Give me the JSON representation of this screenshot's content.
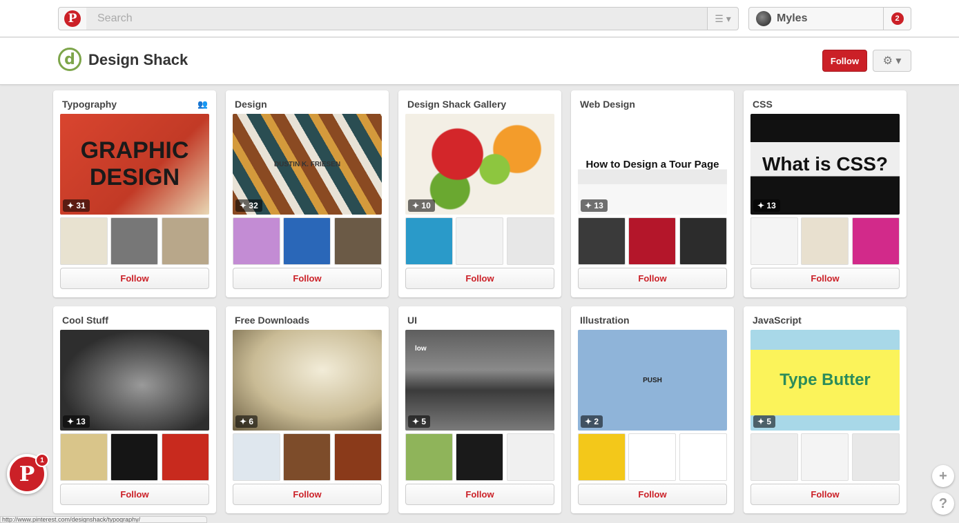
{
  "topbar": {
    "search_placeholder": "Search",
    "user_name": "Myles",
    "notification_count": "2"
  },
  "profile": {
    "avatar_letter": "d",
    "name": "Design Shack",
    "follow_label": "Follow"
  },
  "boards": [
    {
      "title": "Typography",
      "pin_count": "31",
      "cover_text": "GRAPHIC DESIGN",
      "follow_label": "Follow"
    },
    {
      "title": "Design",
      "pin_count": "32",
      "cover_text": "DUSTIN K. FRIESEN",
      "follow_label": "Follow"
    },
    {
      "title": "Design Shack Gallery",
      "pin_count": "10",
      "cover_text": "",
      "follow_label": "Follow"
    },
    {
      "title": "Web Design",
      "pin_count": "13",
      "cover_text": "How to Design a Tour Page",
      "follow_label": "Follow"
    },
    {
      "title": "CSS",
      "pin_count": "13",
      "cover_text": "What is CSS?",
      "follow_label": "Follow"
    },
    {
      "title": "Cool Stuff",
      "pin_count": "13",
      "cover_text": "",
      "follow_label": "Follow"
    },
    {
      "title": "Free Downloads",
      "pin_count": "6",
      "cover_text": "",
      "follow_label": "Follow"
    },
    {
      "title": "UI",
      "pin_count": "5",
      "cover_text": "low",
      "follow_label": "Follow"
    },
    {
      "title": "Illustration",
      "pin_count": "2",
      "cover_text": "PUSH",
      "follow_label": "Follow"
    },
    {
      "title": "JavaScript",
      "pin_count": "5",
      "cover_text": "Type Butter",
      "follow_label": "Follow"
    }
  ],
  "floating": {
    "pin_badge": "1",
    "add_symbol": "+",
    "help_symbol": "?"
  },
  "status_url": "http://www.pinterest.com/designshack/typography/"
}
